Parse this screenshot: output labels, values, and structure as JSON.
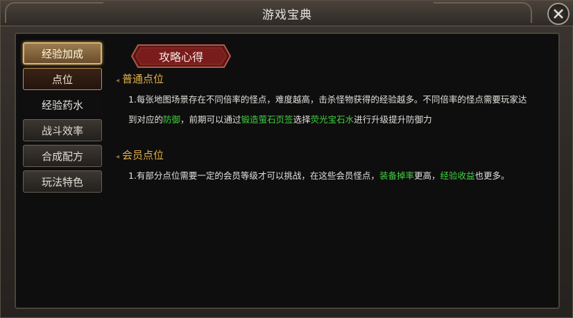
{
  "window": {
    "title": "游戏宝典"
  },
  "sidebar": {
    "items": [
      {
        "label": "经验加成"
      },
      {
        "label": "点位"
      },
      {
        "label": "经验药水"
      },
      {
        "label": "战斗效率"
      },
      {
        "label": "合成配方"
      },
      {
        "label": "玩法特色"
      }
    ]
  },
  "main": {
    "banner": "攻略心得",
    "sections": [
      {
        "title": "普通点位",
        "p1": "1.每张地图场景存在不同倍率的怪点，难度越高，击杀怪物获得的经验越多。不同倍率的怪点需要玩家达",
        "p2_a": "到对应的",
        "p2_hl1": "防御",
        "p2_b": "，前期可以通过",
        "p2_hl2": "锻造萤石页签",
        "p2_c": "选择",
        "p2_hl3": "荧光宝石水",
        "p2_d": "进行升级提升防御力"
      },
      {
        "title": "会员点位",
        "p_a": "1.有部分点位需要一定的会员等级才可以挑战，在这些会员怪点，",
        "p_hl1": "装备掉率",
        "p_b": "更高，",
        "p_hl2": "经验收益",
        "p_c": "也更多。"
      }
    ]
  },
  "colors": {
    "accent_gold": "#e5b04a",
    "highlight_green": "#3fd23f",
    "banner_red": "#7a1c1c"
  }
}
